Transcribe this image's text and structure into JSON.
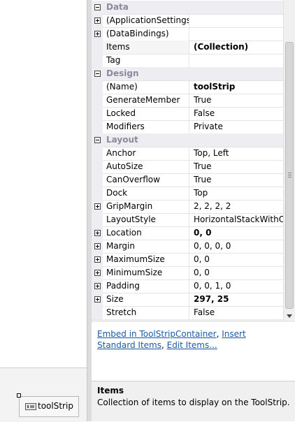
{
  "property_grid": {
    "rows": [
      {
        "type": "category",
        "label": "Data",
        "expanded": true
      },
      {
        "type": "property",
        "name": "(ApplicationSettings)",
        "value": "",
        "expandable": true
      },
      {
        "type": "property",
        "name": "(DataBindings)",
        "value": "",
        "expandable": true
      },
      {
        "type": "property",
        "name": "Items",
        "value": "(Collection)",
        "bold": true,
        "selected": true
      },
      {
        "type": "property",
        "name": "Tag",
        "value": ""
      },
      {
        "type": "category",
        "label": "Design",
        "expanded": true
      },
      {
        "type": "property",
        "name": "(Name)",
        "value": "toolStrip",
        "bold": true
      },
      {
        "type": "property",
        "name": "GenerateMember",
        "value": "True"
      },
      {
        "type": "property",
        "name": "Locked",
        "value": "False"
      },
      {
        "type": "property",
        "name": "Modifiers",
        "value": "Private"
      },
      {
        "type": "category",
        "label": "Layout",
        "expanded": true
      },
      {
        "type": "property",
        "name": "Anchor",
        "value": "Top, Left"
      },
      {
        "type": "property",
        "name": "AutoSize",
        "value": "True"
      },
      {
        "type": "property",
        "name": "CanOverflow",
        "value": "True"
      },
      {
        "type": "property",
        "name": "Dock",
        "value": "Top"
      },
      {
        "type": "property",
        "name": "GripMargin",
        "value": "2, 2, 2, 2",
        "expandable": true
      },
      {
        "type": "property",
        "name": "LayoutStyle",
        "value": "HorizontalStackWithOve"
      },
      {
        "type": "property",
        "name": "Location",
        "value": "0, 0",
        "bold": true,
        "expandable": true
      },
      {
        "type": "property",
        "name": "Margin",
        "value": "0, 0, 0, 0",
        "expandable": true
      },
      {
        "type": "property",
        "name": "MaximumSize",
        "value": "0, 0",
        "expandable": true
      },
      {
        "type": "property",
        "name": "MinimumSize",
        "value": "0, 0",
        "expandable": true
      },
      {
        "type": "property",
        "name": "Padding",
        "value": "0, 0, 1, 0",
        "expandable": true
      },
      {
        "type": "property",
        "name": "Size",
        "value": "297, 25",
        "bold": true,
        "expandable": true
      },
      {
        "type": "property",
        "name": "Stretch",
        "value": "False"
      }
    ]
  },
  "commands": {
    "embed_link": "Embed in ToolStripContainer",
    "separator1": ", ",
    "insert_link": "Insert Standard Items",
    "separator2": ", ",
    "edit_link": "Edit Items..."
  },
  "description": {
    "title": "Items",
    "text": "Collection of items to display on the ToolStrip."
  },
  "component_tray": {
    "item_label": "toolStrip",
    "item_icon": "toolstrip-icon"
  },
  "colors": {
    "category_text": "#8a8a9e",
    "category_bg": "#eeeef2",
    "link": "#1a5aa8"
  }
}
